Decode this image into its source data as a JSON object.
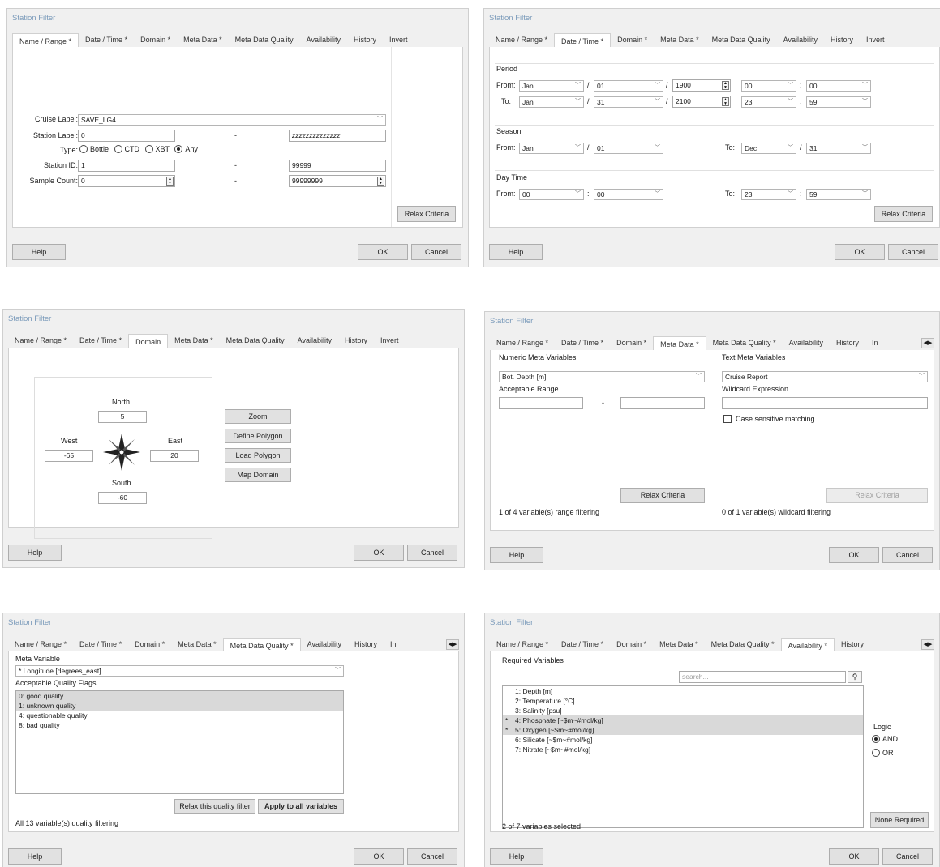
{
  "title": "Station Filter",
  "tabs_full": [
    "Name / Range *",
    "Date / Time *",
    "Domain *",
    "Meta Data *",
    "Meta Data Quality",
    "Availability",
    "History",
    "Invert"
  ],
  "tabs_dom": [
    "Name / Range *",
    "Date / Time *",
    "Domain",
    "Meta Data *",
    "Meta Data Quality",
    "Availability",
    "History",
    "Invert"
  ],
  "tabs_meta": [
    "Name / Range *",
    "Date / Time *",
    "Domain *",
    "Meta Data *",
    "Meta Data Quality *",
    "Availability",
    "History",
    "In"
  ],
  "tabs_mdq": [
    "Name / Range *",
    "Date / Time *",
    "Domain *",
    "Meta Data *",
    "Meta Data Quality *",
    "Availability",
    "History",
    "In"
  ],
  "tabs_av": [
    "Name / Range *",
    "Date / Time *",
    "Domain *",
    "Meta Data *",
    "Meta Data Quality *",
    "Availability *",
    "History"
  ],
  "common": {
    "help": "Help",
    "ok": "OK",
    "cancel": "Cancel",
    "relax": "Relax Criteria",
    "dash": "-",
    "colon": ":",
    "slash": "/"
  },
  "name_range": {
    "cruise_label": "Cruise Label:",
    "cruise_value": "SAVE_LG4",
    "station_label": "Station Label:",
    "station_from": "0",
    "station_to": "zzzzzzzzzzzzzz",
    "type_label": "Type:",
    "types": [
      "Bottle",
      "CTD",
      "XBT",
      "Any"
    ],
    "station_id_label": "Station ID:",
    "id_from": "1",
    "id_to": "99999",
    "sample_count_label": "Sample Count:",
    "count_from": "0",
    "count_to": "99999999"
  },
  "date_time": {
    "period": "Period",
    "from": "From:",
    "to": "To:",
    "p_from": [
      "Jan",
      "01",
      "1900",
      "00",
      "00"
    ],
    "p_to": [
      "Jan",
      "31",
      "2100",
      "23",
      "59"
    ],
    "season": "Season",
    "s_from": [
      "Jan",
      "01"
    ],
    "s_to": [
      "Dec",
      "31"
    ],
    "day_time": "Day Time",
    "d_from": [
      "00",
      "00"
    ],
    "d_to": [
      "23",
      "59"
    ]
  },
  "domain": {
    "north": "North",
    "north_v": "5",
    "west": "West",
    "west_v": "-65",
    "east": "East",
    "east_v": "20",
    "south": "South",
    "south_v": "-60",
    "buttons": [
      "Zoom",
      "Define Polygon",
      "Load Polygon",
      "Map Domain"
    ]
  },
  "meta": {
    "numeric": "Numeric Meta Variables",
    "text": "Text Meta Variables",
    "num_var": "Bot. Depth [m]",
    "acc_range": "Acceptable Range",
    "text_var": "Cruise Report",
    "wildcard": "Wildcard Expression",
    "case": "Case sensitive matching",
    "num_status": "1 of 4 variable(s) range filtering",
    "text_status": "0 of 1 variable(s) wildcard filtering"
  },
  "mdq": {
    "meta_var": "Meta Variable",
    "var_value": "* Longitude [degrees_east]",
    "flags": "Acceptable Quality Flags",
    "items": [
      "0: good quality",
      "1: unknown quality",
      "4: questionable quality",
      "8: bad quality"
    ],
    "relax": "Relax this quality filter",
    "apply": "Apply to all variables",
    "status": "All 13 variable(s) quality filtering"
  },
  "avail": {
    "required": "Required Variables",
    "search": "search...",
    "items": [
      "1: Depth [m]",
      "2: Temperature [°C]",
      "3: Salinity [psu]",
      "4: Phosphate [~$m~#mol/kg]",
      "5: Oxygen [~$m~#mol/kg]",
      "6: Silicate [~$m~#mol/kg]",
      "7: Nitrate [~$m~#mol/kg]"
    ],
    "starred": [
      "",
      "",
      "",
      "*",
      "*",
      "",
      ""
    ],
    "logic": "Logic",
    "and": "AND",
    "or": "OR",
    "status": "2 of 7 variables selected",
    "none": "None Required"
  }
}
